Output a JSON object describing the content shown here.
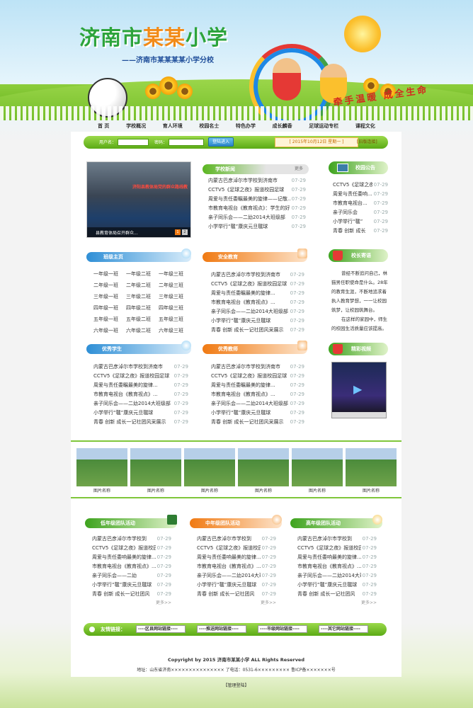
{
  "header": {
    "title_a": "济南市",
    "title_b": "某某",
    "title_c": "小学",
    "subtitle": "——济南市某某某某小学分校",
    "slogan": "牵手温暖 成全生命"
  },
  "nav": [
    "首 页",
    "学校概况",
    "育人环境",
    "校园名士",
    "特色办学",
    "成长麟香",
    "足球运动专栏",
    "课程文化"
  ],
  "login": {
    "user_label": "用户名：",
    "pass_label": "密码：",
    "button": "登陆进入",
    "date": "[ 2015年10月12日 星期一 ]",
    "oldver": "[旧版连接]"
  },
  "slideshow": {
    "banner": "济阳县教体局党的群众路线教",
    "caption": "县教育体局召开群众...",
    "pages": [
      "1",
      "2"
    ]
  },
  "news": {
    "title": "学校新闻",
    "more": "更多",
    "items": [
      {
        "t": "内蒙古巴彦淖尔市学校到济南市",
        "d": "07-29"
      },
      {
        "t": "CCTV5《足球之夜》报道校园足球",
        "d": "07-29"
      },
      {
        "t": "周爱与责任委瞩最美的旋律——记敬...",
        "d": "07-29"
      },
      {
        "t": "市教育电视台《教育视点》：学生的好...",
        "d": "07-29"
      },
      {
        "t": "亲子同乐会——二幼2014大班级部",
        "d": "07-29"
      },
      {
        "t": "小学举行“毽”康庆元旦毽球",
        "d": "07-29"
      }
    ]
  },
  "notice": {
    "title": "校园公告",
    "items": [
      {
        "t": "CCTV5《足球之夜》",
        "d": "07-29"
      },
      {
        "t": "周爱与责任委响...",
        "d": "07-29"
      },
      {
        "t": "市教育电视台...",
        "d": "07-29"
      },
      {
        "t": "亲子同乐会",
        "d": "07-29"
      },
      {
        "t": "小学举行“毽”",
        "d": "07-29"
      },
      {
        "t": "青春 创新 成长",
        "d": "07-29"
      }
    ]
  },
  "classes": {
    "title": "班级主页",
    "items": [
      "一年级一班",
      "一年级二班",
      "一年级三班",
      "二年级一班",
      "二年级二班",
      "二年级三班",
      "三年级一班",
      "三年级二班",
      "三年级三班",
      "四年级一班",
      "四年级二班",
      "四年级三班",
      "五年级一班",
      "五年级二班",
      "五年级三班",
      "六年级一班",
      "六年级二班",
      "六年级三班"
    ]
  },
  "safety": {
    "title": "安全教育",
    "items": [
      {
        "t": "内蒙古巴彦淖尔市学校到济南市",
        "d": "07-29"
      },
      {
        "t": "CCTV5《足球之夜》报道校园足球",
        "d": "07-29"
      },
      {
        "t": "周爱与责任委瞩最美的旋律...",
        "d": "07-29"
      },
      {
        "t": "市教育电视台《教育视点》...",
        "d": "07-29"
      },
      {
        "t": "亲子同乐会——二幼2014大班级部",
        "d": "07-29"
      },
      {
        "t": "小学举行“毽”康庆元旦毽球",
        "d": "07-29"
      },
      {
        "t": "青春 创新 成长一记社团风采展示",
        "d": "07-29"
      }
    ]
  },
  "principal": {
    "title": "校长寄语",
    "p1": "曾经不断追问自己，林猫男任职使命是什么。28年的教育生涯，不断地追求着执人教育梦想，一一让校园筑梦，让校园筑舞台。",
    "p2": "在这样的家园中，师生的校园生活质量应该提高。"
  },
  "students": {
    "title": "优秀学生",
    "items": [
      {
        "t": "内蒙古巴彦淖尔市学校到济南市",
        "d": "07-29"
      },
      {
        "t": "CCTV5《足球之夜》报道校园足球",
        "d": "07-29"
      },
      {
        "t": "周爱与责任委瞩最美的旋律...",
        "d": "07-29"
      },
      {
        "t": "市教育电视台《教育视点》...",
        "d": "07-29"
      },
      {
        "t": "亲子同乐会——二幼2014大班级部",
        "d": "07-29"
      },
      {
        "t": "小学举行“毽”康庆元旦毽球",
        "d": "07-29"
      },
      {
        "t": "青春 创新 成长一记社团风采展示",
        "d": "07-29"
      }
    ]
  },
  "teachers": {
    "title": "优秀教师",
    "items": [
      {
        "t": "内蒙古巴彦淖尔市学校到济南市",
        "d": "07-29"
      },
      {
        "t": "CCTV5《足球之夜》报道校园足球",
        "d": "07-29"
      },
      {
        "t": "周爱与责任委瞩最美的旋律...",
        "d": "07-29"
      },
      {
        "t": "市教育电视台《教育视点》...",
        "d": "07-29"
      },
      {
        "t": "亲子同乐会——二幼2014大班级部",
        "d": "07-29"
      },
      {
        "t": "小学举行“毽”康庆元旦毽球",
        "d": "07-29"
      },
      {
        "t": "青春 创新 成长一记社团风采展示",
        "d": "07-29"
      }
    ]
  },
  "video": {
    "title": "精彩视频"
  },
  "photos": {
    "captions": [
      "图片名称",
      "图片名称",
      "图片名称",
      "图片名称",
      "图片名称",
      "图片名称"
    ]
  },
  "low": {
    "title": "低年级团队活动",
    "more": "更多>>",
    "items": [
      {
        "t": "内蒙古巴彦淖尔市学校到",
        "d": "07-29"
      },
      {
        "t": "CCTV5《足球之夜》报道校园",
        "d": "07-29"
      },
      {
        "t": "周爱与责任委响最美的旋律...",
        "d": "07-29"
      },
      {
        "t": "市教育电视台《教育视点》...",
        "d": "07-29"
      },
      {
        "t": "亲子同乐会——二幼",
        "d": "07-29"
      },
      {
        "t": "小学举行“毽”康庆元旦毽球",
        "d": "07-29"
      },
      {
        "t": "青春 创新 成长一记社团风",
        "d": "07-29"
      }
    ]
  },
  "mid": {
    "title": "中年级团队活动",
    "more": "更多>>",
    "items": [
      {
        "t": "内蒙古巴彦淖尔市学校到",
        "d": "07-29"
      },
      {
        "t": "CCTV5《足球之夜》报道校园",
        "d": "07-29"
      },
      {
        "t": "周爱与责任委响最美的旋律...",
        "d": "07-29"
      },
      {
        "t": "市教育电视台《教育视点》...",
        "d": "07-29"
      },
      {
        "t": "亲子同乐会——二幼2014大班",
        "d": "07-29"
      },
      {
        "t": "小学举行“毽”康庆元旦毽球",
        "d": "07-29"
      },
      {
        "t": "青春 创新 成长一记社团风",
        "d": "07-29"
      }
    ]
  },
  "high": {
    "title": "高年级团队活动",
    "more": "更多>>",
    "items": [
      {
        "t": "内蒙古巴彦淖尔市学校到",
        "d": "07-29"
      },
      {
        "t": "CCTV5《足球之夜》报道校园",
        "d": "07-29"
      },
      {
        "t": "周爱与责任委响最美的旋律...",
        "d": "07-29"
      },
      {
        "t": "市教育电视台《教育视点》...",
        "d": "07-29"
      },
      {
        "t": "亲子同乐会——二幼2014大班",
        "d": "07-29"
      },
      {
        "t": "小学举行“毽”康庆元旦毽球",
        "d": "07-29"
      },
      {
        "t": "青春 创新 成长一记社团风",
        "d": "07-29"
      }
    ]
  },
  "friends": {
    "label": "友情链接：",
    "selects": [
      "----区县网站链接----",
      "----推送网站链接----",
      "----市级网站链接----",
      "----其它网站链接----"
    ]
  },
  "footer": {
    "copyright": "Copyright by 2015 济南市某某小学 ALL Rights Reserved",
    "address": "地址：山东省济南×××××××××××××××  了电话：0531-6×××××××××  鲁ICP备×××××××号",
    "admin": "【管理登陆】"
  }
}
